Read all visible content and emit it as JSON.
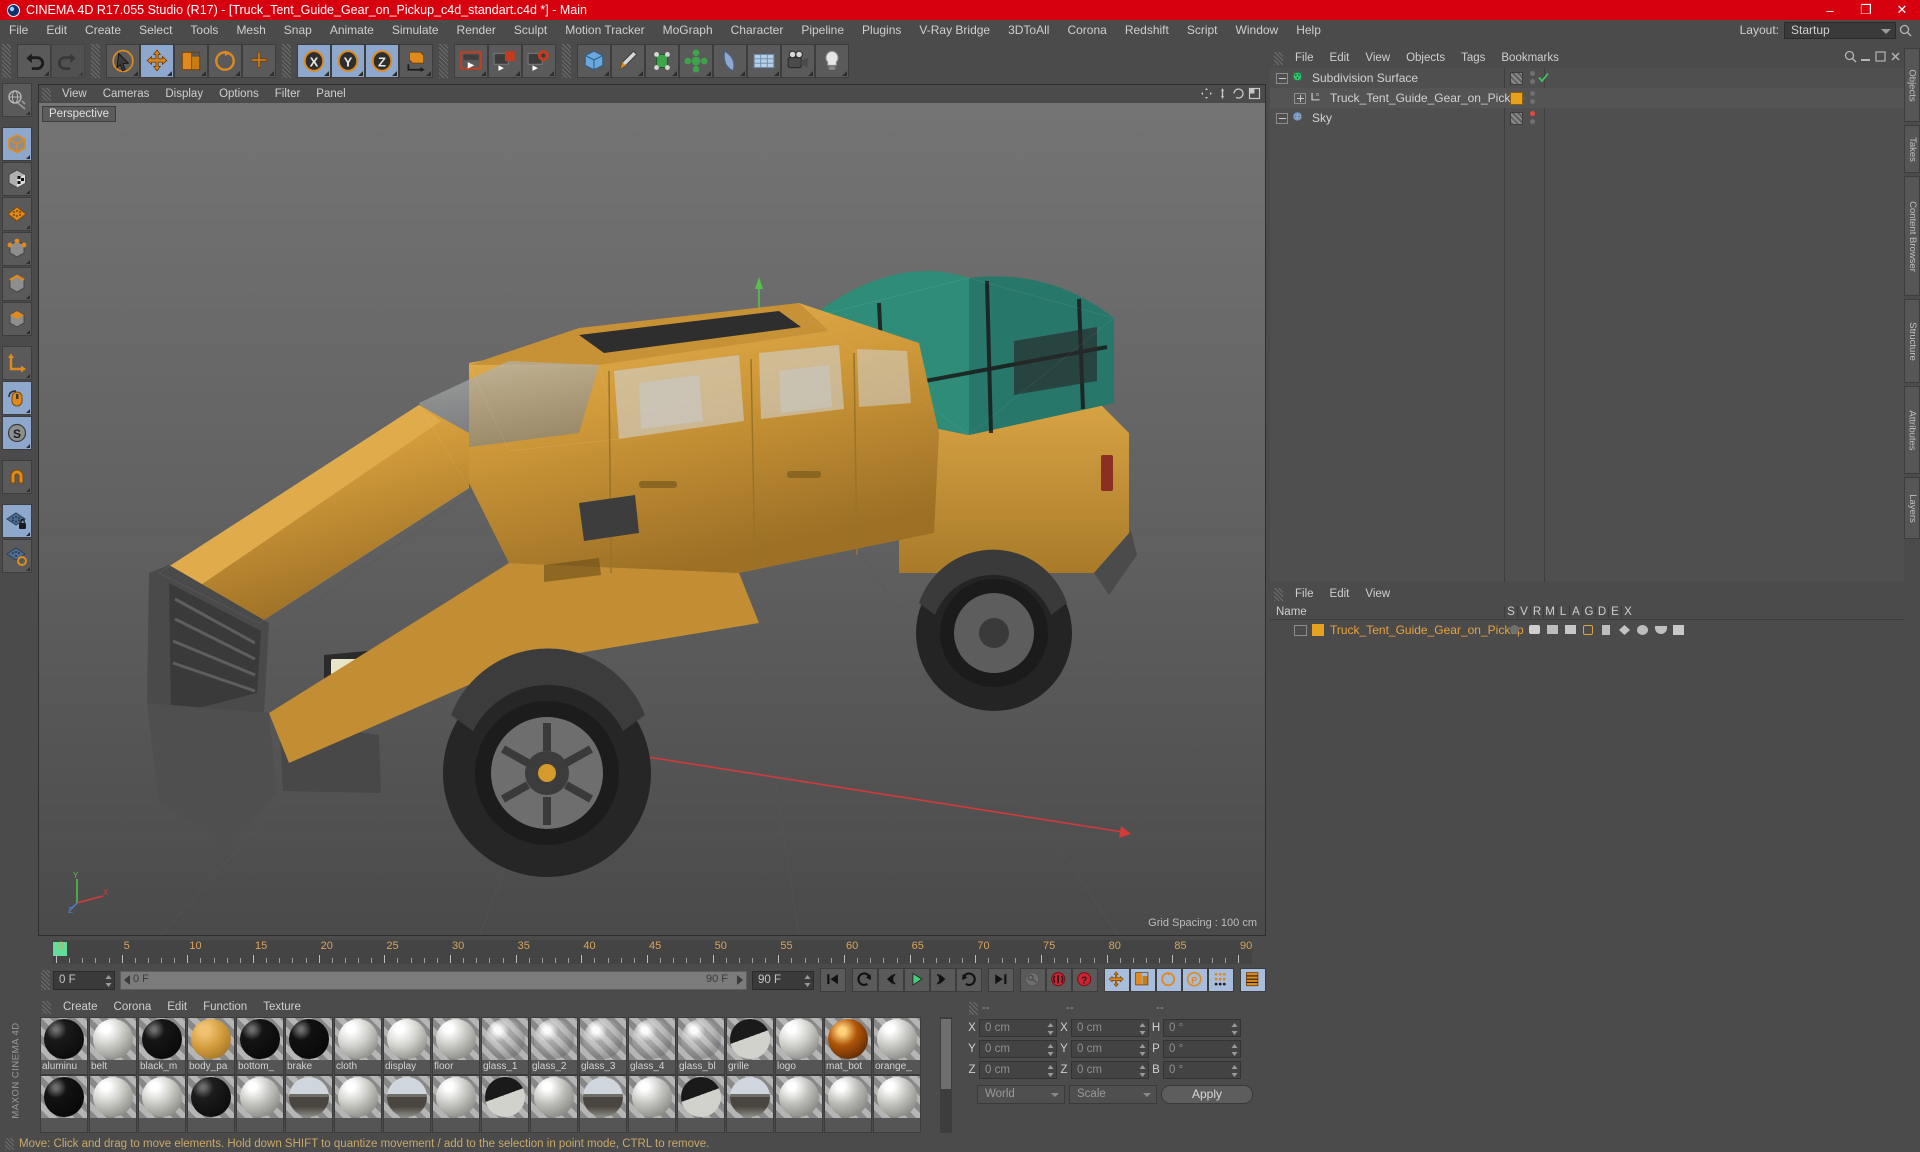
{
  "window": {
    "title": "CINEMA 4D R17.055 Studio (R17) - [Truck_Tent_Guide_Gear_on_Pickup_c4d_standart.c4d *] - Main",
    "minimize": "–",
    "maximize": "❐",
    "close": "✕",
    "title_bg": "#d6000f"
  },
  "menubar": {
    "items": [
      "File",
      "Edit",
      "Create",
      "Select",
      "Tools",
      "Mesh",
      "Snap",
      "Animate",
      "Simulate",
      "Render",
      "Sculpt",
      "Motion Tracker",
      "MoGraph",
      "Character",
      "Pipeline",
      "Plugins",
      "V-Ray Bridge",
      "3DToAll",
      "Corona",
      "Redshift",
      "Script",
      "Window",
      "Help"
    ],
    "layout_label": "Layout:",
    "layout_value": "Startup"
  },
  "toolbar": {
    "groups": [
      {
        "name": "history",
        "buttons": [
          {
            "name": "undo-button",
            "icon": "undo",
            "state": "normal"
          },
          {
            "name": "redo-button",
            "icon": "redo",
            "state": "disabled"
          }
        ]
      },
      {
        "name": "transform",
        "buttons": [
          {
            "name": "select-tool-button",
            "icon": "cursor",
            "state": "normal"
          },
          {
            "name": "move-tool-button",
            "icon": "move",
            "state": "selected"
          },
          {
            "name": "scale-tool-button",
            "icon": "scale",
            "state": "normal"
          },
          {
            "name": "rotate-tool-button",
            "icon": "rotate",
            "state": "normal"
          },
          {
            "name": "move-axis-button",
            "icon": "plus-axis",
            "state": "normal"
          }
        ]
      },
      {
        "name": "axis-lock",
        "buttons": [
          {
            "name": "x-axis-lock-button",
            "icon": "x",
            "state": "selected"
          },
          {
            "name": "y-axis-lock-button",
            "icon": "y",
            "state": "selected"
          },
          {
            "name": "z-axis-lock-button",
            "icon": "z",
            "state": "selected"
          },
          {
            "name": "world-object-axis-button",
            "icon": "world-axis",
            "state": "normal"
          }
        ]
      },
      {
        "name": "render",
        "buttons": [
          {
            "name": "render-view-button",
            "icon": "render-view",
            "state": "normal"
          },
          {
            "name": "render-to-picture-viewer-button",
            "icon": "render-pv",
            "state": "normal"
          },
          {
            "name": "render-settings-button",
            "icon": "render-settings",
            "state": "normal"
          }
        ]
      },
      {
        "name": "create",
        "buttons": [
          {
            "name": "add-cube-button",
            "icon": "cube",
            "state": "normal"
          },
          {
            "name": "add-spline-button",
            "icon": "pen",
            "state": "normal"
          },
          {
            "name": "add-nurbs-button",
            "icon": "nurbs",
            "state": "normal"
          },
          {
            "name": "add-array-button",
            "icon": "array",
            "state": "normal"
          },
          {
            "name": "add-bend-button",
            "icon": "deformer",
            "state": "normal"
          },
          {
            "name": "add-floor-button",
            "icon": "floor",
            "state": "normal"
          },
          {
            "name": "add-camera-button",
            "icon": "camera",
            "state": "normal"
          },
          {
            "name": "add-light-button",
            "icon": "light",
            "state": "normal"
          }
        ]
      }
    ]
  },
  "left_palette": {
    "buttons": [
      {
        "name": "make-editable-button",
        "icon": "globe-edit",
        "state": "normal"
      },
      {
        "name": "model-mode-button",
        "icon": "model-cube",
        "state": "selected"
      },
      {
        "name": "texture-mode-button",
        "icon": "texture-cube",
        "state": "normal"
      },
      {
        "name": "polygon-mode-button",
        "icon": "polygon-grid",
        "state": "normal"
      },
      {
        "name": "point-mode-button",
        "icon": "point-cube",
        "state": "normal"
      },
      {
        "name": "edge-mode-button",
        "icon": "edge-cube",
        "state": "normal"
      },
      {
        "name": "polygon-face-mode-button",
        "icon": "face-cube",
        "state": "normal"
      },
      {
        "name": "object-axis-button",
        "icon": "axis-L",
        "state": "normal"
      },
      {
        "name": "viewport-solo-button",
        "icon": "mouse",
        "state": "selected"
      },
      {
        "name": "enable-snap-button",
        "icon": "snap-s",
        "state": "selected"
      },
      {
        "name": "magnet-button",
        "icon": "magnet",
        "state": "normal"
      },
      {
        "name": "lock-workplane-button",
        "icon": "grid-lock",
        "state": "selected"
      },
      {
        "name": "workplane-button",
        "icon": "grid-plane",
        "state": "normal"
      }
    ],
    "logo": "MAXON CINEMA 4D"
  },
  "viewport": {
    "menu": [
      "View",
      "Cameras",
      "Display",
      "Options",
      "Filter",
      "Panel"
    ],
    "label": "Perspective",
    "grid_spacing": "Grid Spacing : 100 cm",
    "axis_labels": [
      "Y",
      "X",
      "Z"
    ]
  },
  "timeline": {
    "ticks": [
      "0",
      "5",
      "10",
      "15",
      "20",
      "25",
      "30",
      "35",
      "40",
      "45",
      "50",
      "55",
      "60",
      "65",
      "70",
      "75",
      "80",
      "85",
      "90"
    ],
    "current_frame": "0 F",
    "range_start": "0 F",
    "range_end": "90 F",
    "max_frame": "90 F",
    "playback": [
      {
        "name": "go-to-start-button",
        "icon": "skip-back"
      },
      {
        "name": "play-reverse-button",
        "icon": "loop-back"
      },
      {
        "name": "previous-frame-button",
        "icon": "prev-frame"
      },
      {
        "name": "play-forward-button",
        "icon": "play"
      },
      {
        "name": "next-frame-button",
        "icon": "next-frame"
      },
      {
        "name": "play-loop-button",
        "icon": "loop"
      },
      {
        "name": "go-to-end-button",
        "icon": "skip-forward"
      },
      {
        "name": "autokey-button",
        "icon": "key-ghost"
      },
      {
        "name": "record-active-objects-button",
        "icon": "record"
      },
      {
        "name": "keyframe-selection-button",
        "icon": "question"
      },
      {
        "name": "record-position-button",
        "icon": "pos-key"
      },
      {
        "name": "record-scale-button",
        "icon": "scale-key"
      },
      {
        "name": "record-rotation-button",
        "icon": "rot-key"
      },
      {
        "name": "record-param-button",
        "icon": "param-key"
      },
      {
        "name": "record-pla-button",
        "icon": "pla-key"
      },
      {
        "name": "timeline-view-button",
        "icon": "timeline"
      }
    ]
  },
  "material_manager": {
    "menu": [
      "Create",
      "Corona",
      "Edit",
      "Function",
      "Texture"
    ],
    "row1": [
      {
        "name": "aluminu",
        "color": "#1a1a1a",
        "type": "dark"
      },
      {
        "name": "belt",
        "color": "#c9c9c4",
        "type": "light"
      },
      {
        "name": "black_m",
        "color": "#161616",
        "type": "dark"
      },
      {
        "name": "body_pa",
        "color": "#d09a3a",
        "type": "orange"
      },
      {
        "name": "bottom_",
        "color": "#141414",
        "type": "dark"
      },
      {
        "name": "brake",
        "color": "#111111",
        "type": "dark"
      },
      {
        "name": "cloth",
        "color": "#cfcfcb",
        "type": "light"
      },
      {
        "name": "display",
        "color": "#d2d2cd",
        "type": "light"
      },
      {
        "name": "floor",
        "color": "#c6c6c2",
        "type": "light"
      },
      {
        "name": "glass_1",
        "color": "#d8d8d8",
        "type": "glass"
      },
      {
        "name": "glass_2",
        "color": "#dadada",
        "type": "glass"
      },
      {
        "name": "glass_3",
        "color": "#d6d6d6",
        "type": "glass"
      },
      {
        "name": "glass_4",
        "color": "#dcdcdc",
        "type": "glass"
      },
      {
        "name": "glass_bl",
        "color": "#d9d9d9",
        "type": "glass"
      },
      {
        "name": "grille",
        "color": "#2a2a2a",
        "type": "halfdark"
      },
      {
        "name": "logo",
        "color": "#cdcdc9",
        "type": "light"
      },
      {
        "name": "mat_bot",
        "color": "#b0560a",
        "type": "amber"
      },
      {
        "name": "orange_",
        "color": "#c6c6c2",
        "type": "light"
      }
    ],
    "row2": [
      {
        "name": "",
        "color": "#121212",
        "type": "dark"
      },
      {
        "name": "",
        "color": "#c9c9c4",
        "type": "light"
      },
      {
        "name": "",
        "color": "#c9c9c4",
        "type": "light"
      },
      {
        "name": "",
        "color": "#1d1d1d",
        "type": "dark"
      },
      {
        "name": "",
        "color": "#c2c2be",
        "type": "light"
      },
      {
        "name": "",
        "color": "#8d8d88",
        "type": "chrome"
      },
      {
        "name": "",
        "color": "#c9c9c4",
        "type": "light"
      },
      {
        "name": "",
        "color": "#8a8a85",
        "type": "chrome"
      },
      {
        "name": "",
        "color": "#c6c6c2",
        "type": "light"
      },
      {
        "name": "",
        "color": "#3a3a3a",
        "type": "halfdark"
      },
      {
        "name": "",
        "color": "#bdbdb9",
        "type": "light"
      },
      {
        "name": "",
        "color": "#8d8d88",
        "type": "chrome"
      },
      {
        "name": "",
        "color": "#c2c2be",
        "type": "light"
      },
      {
        "name": "",
        "color": "#2a2a2a",
        "type": "halfdark"
      },
      {
        "name": "",
        "color": "#6f6f6b",
        "type": "chrome"
      },
      {
        "name": "",
        "color": "#bdbdb9",
        "type": "light"
      },
      {
        "name": "",
        "color": "#b9b9b5",
        "type": "light"
      },
      {
        "name": "",
        "color": "#c2c2be",
        "type": "light"
      }
    ]
  },
  "coordinates": {
    "headers": [
      "--",
      "--",
      "--"
    ],
    "rows": [
      {
        "label_pos": "X",
        "value_pos": "0 cm",
        "label_size": "X",
        "value_size": "0 cm",
        "label_rot": "H",
        "value_rot": "0 °"
      },
      {
        "label_pos": "Y",
        "value_pos": "0 cm",
        "label_size": "Y",
        "value_size": "0 cm",
        "label_rot": "P",
        "value_rot": "0 °"
      },
      {
        "label_pos": "Z",
        "value_pos": "0 cm",
        "label_size": "Z",
        "value_size": "0 cm",
        "label_rot": "B",
        "value_rot": "0 °"
      }
    ],
    "system": "World",
    "mode": "Scale",
    "apply": "Apply"
  },
  "object_manager": {
    "menu": [
      "File",
      "Edit",
      "View",
      "Objects",
      "Tags",
      "Bookmarks"
    ],
    "items": [
      {
        "name": "Subdivision Surface",
        "depth": 0,
        "icon": "subdivision",
        "tag_color": "none",
        "dot": "check"
      },
      {
        "name": "Truck_Tent_Guide_Gear_on_Pickup",
        "depth": 1,
        "icon": "null-object",
        "tag_color": "#e6a11e",
        "dot": "none"
      },
      {
        "name": "Sky",
        "depth": 0,
        "icon": "sky",
        "tag_color": "none",
        "dot": "red"
      }
    ]
  },
  "layer_manager": {
    "menu": [
      "File",
      "Edit",
      "View"
    ],
    "columns": [
      "Name",
      "S",
      "V",
      "R",
      "M",
      "L",
      "A",
      "G",
      "D",
      "E",
      "X"
    ],
    "rows": [
      {
        "name": "Truck_Tent_Guide_Gear_on_Pickup",
        "color": "#e6a11e"
      }
    ]
  },
  "right_tabs": [
    "Objects",
    "Takes",
    "Content Browser",
    "Structure",
    "Attributes",
    "Layers"
  ],
  "statusbar": {
    "message": "Move: Click and drag to move elements. Hold down SHIFT to quantize movement / add to the selection in point mode, CTRL to remove."
  }
}
